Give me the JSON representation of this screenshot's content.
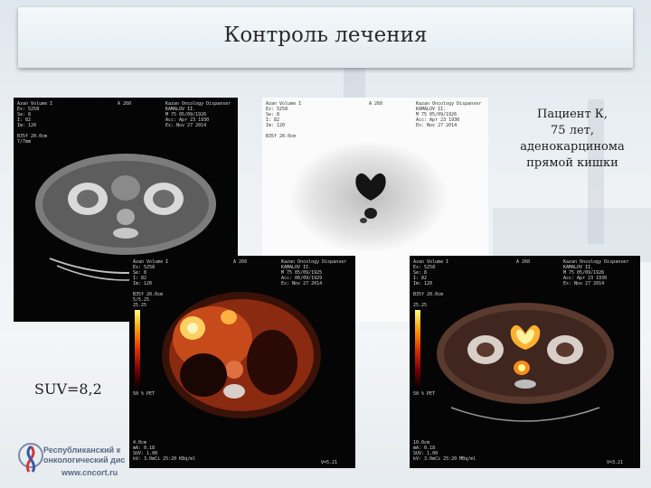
{
  "slide": {
    "title": "Контроль лечения",
    "patient_lines": [
      "Пациент К,",
      "75 лет,",
      "аденокарцинома",
      "прямой кишки"
    ],
    "suv_label": "SUV=8,2"
  },
  "logo": {
    "line1": "Республиканский к",
    "line2": "онкологический дис",
    "url": "www.cncort.ru"
  },
  "scans": {
    "ct": {
      "left_meta": "Azan Volume I\nEx: 5258\nSe: 8\nI: 82\nIm: 120\n\nB35f 20.0cm\n7/7mm",
      "right_meta": "Kazan Oncology Dispanser\nKAMALOV II.\nM 75 05/09/1926\nAcc: Apr 23 1930\nEx: Nov 27 2014",
      "top_label": "A 260"
    },
    "pet": {
      "left_meta": "Azan Volume I\nEx: 5258\nSe: 8\nI: 82\nIm: 120\n\nB35f 20.0cm",
      "right_meta": "Kazan Oncology Dispanser\nKAMALOV II.\nM 75 05/09/1926\nAcc: Apr 23 1930\nEx: Nov 27 2014",
      "top_label": "A 260"
    },
    "fusion1": {
      "left_meta": "Azan Volume I\nEx: 5258\nSe: 8\nI: 82\nIm: 120\n\nB35f 20.0cm\n5/5.25",
      "right_meta": "Kazan Oncology Dispanser\nKAMALOV II.\nM 75 05/09/1925\nAcc: 06/09/1929\nEx: Nov 27 2014",
      "top_label": "A 260",
      "scale_top": "25.25",
      "scale_bottom": "50 % PET",
      "bottom_meta": "4.0cm\nmA: 0.18\nSUV: 1.00\nkV: 3.0mCi 25:20 KBq/ml",
      "corner": "V=5.21"
    },
    "fusion2": {
      "left_meta": "Azan Volume I\nEx: 5258\nSe: 8\nI: 82\nIm: 120\n\nB35f 20.0cm",
      "right_meta": "Kazan Oncology Dispanser\nKAMALOV II.\nM 75 05/09/1926\nAcc: Apr 23 1930\nEx: Nov 27 2014",
      "top_label": "A 260",
      "scale_top": "25.25",
      "scale_bottom": "50 % PET",
      "bottom_meta": "10.0cm\nmA: 0.18\nSUV: 1.00\nkV: 3.0mCi 25:20 MBq/ml",
      "corner": "V=3.21"
    }
  },
  "colors": {
    "title_bg": "#e9eff4",
    "scale_hot": "#ffff80",
    "scale_mid": "#e03000"
  }
}
